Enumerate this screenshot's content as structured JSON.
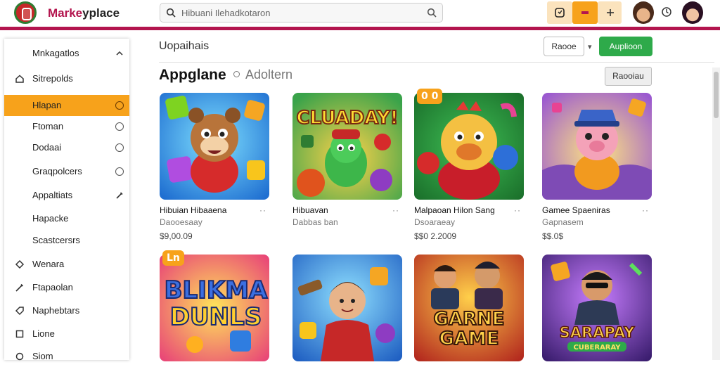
{
  "header": {
    "brand_part1": "Marke",
    "brand_part2": "yplace",
    "search_placeholder": "Hibuani Ilehadkotaron",
    "icons": [
      "logo-icon",
      "search-icon",
      "lens-icon",
      "cart-icon",
      "bag-icon",
      "plus-icon",
      "clock-icon"
    ],
    "accent_color": "#b3154e",
    "orange_color": "#f7a21b"
  },
  "sidebar": {
    "items": [
      {
        "label": "Mnkagatlos",
        "icon": "",
        "right": "chevron-up-icon",
        "active": false
      },
      {
        "label": "Sitrepolds",
        "icon": "house-icon",
        "right": "",
        "active": false
      },
      {
        "label": "Hlapan",
        "icon": "",
        "right": "radio",
        "active": true
      },
      {
        "label": "Ftoman",
        "icon": "",
        "right": "radio",
        "active": false
      },
      {
        "label": "Dodaai",
        "icon": "",
        "right": "radio",
        "active": false
      },
      {
        "label": "Graqpolcers",
        "icon": "",
        "right": "radio",
        "active": false
      },
      {
        "label": "Appaltiats",
        "icon": "",
        "right": "pencil-icon",
        "active": false
      },
      {
        "label": "Hapacke",
        "icon": "",
        "right": "",
        "active": false
      },
      {
        "label": "Scastcersrs",
        "icon": "",
        "right": "",
        "active": false
      },
      {
        "label": "Wenara",
        "icon": "diamond-icon",
        "right": "",
        "active": false
      },
      {
        "label": "Ftapaolan",
        "icon": "edit-icon",
        "right": "",
        "active": false
      },
      {
        "label": "Naphebtars",
        "icon": "tag-icon",
        "right": "",
        "active": false
      },
      {
        "label": "Lione",
        "icon": "square-icon",
        "right": "",
        "active": false
      },
      {
        "label": "Siom",
        "icon": "circle-icon",
        "right": "",
        "active": false
      }
    ]
  },
  "main": {
    "title": "Uopaihais",
    "btn_secondary": "Raooe",
    "btn_primary": "Auplioon",
    "section_title": "Appglane",
    "section_sub": "Adoltern",
    "section_btn": "Raooiau",
    "cards": [
      {
        "name": "Hibuian Hibaaena",
        "category": "Daooesaay",
        "price": "$9,00.09",
        "badge": "",
        "art": "bear-game-art"
      },
      {
        "name": "Hibuavan",
        "category": "Dabbas ban",
        "price": "",
        "badge": "",
        "art": "gluaday-game-art"
      },
      {
        "name": "Malpaoan Hilon Sang",
        "category": "Dsoaraeay",
        "price": "$$0 2.2009",
        "badge": "0 0",
        "art": "chicken-game-art"
      },
      {
        "name": "Gamee Spaeniras",
        "category": "Gapnasem",
        "price": "$$.0$",
        "badge": "",
        "art": "pig-game-art"
      },
      {
        "name": "",
        "category": "",
        "price": "",
        "badge": "Ln",
        "art": "blikma-game-art",
        "art_text1": "BLIKMA",
        "art_text2": "DUNLS"
      },
      {
        "name": "",
        "category": "",
        "price": "",
        "badge": "",
        "art": "hero-game-art"
      },
      {
        "name": "",
        "category": "",
        "price": "",
        "badge": "",
        "art": "garne-game-art",
        "art_text1": "GARNE",
        "art_text2": "GAME"
      },
      {
        "name": "",
        "category": "",
        "price": "",
        "badge": "",
        "art": "sarapay-game-art",
        "art_text1": "SARAPAY",
        "art_text2": "CUBERARAY"
      }
    ],
    "card_art_title": "CLUADAY!"
  }
}
